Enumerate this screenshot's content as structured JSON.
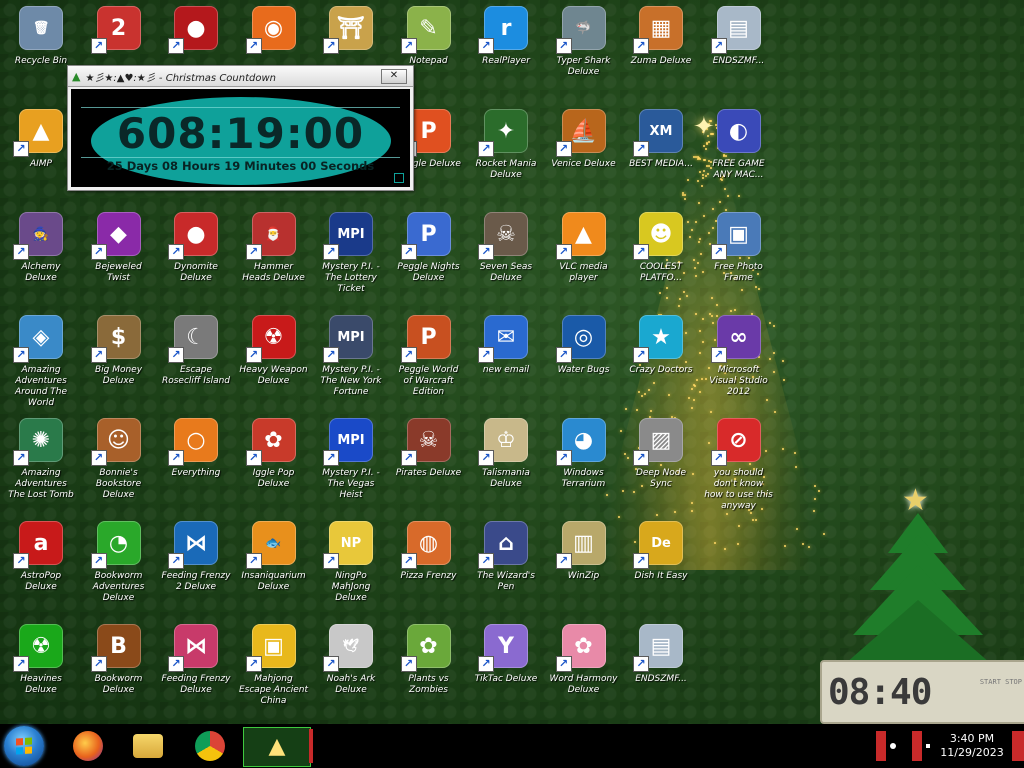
{
  "desktop": {
    "icons": [
      {
        "label": "Recycle Bin",
        "glyph": "🗑",
        "color": "#6e8aa8",
        "col": 0,
        "row": 0,
        "shortcut": false
      },
      {
        "label": "",
        "glyph": "2",
        "color": "#c9332f",
        "col": 1,
        "row": 0,
        "shortcut": true
      },
      {
        "label": "",
        "glyph": "●",
        "color": "#b4181c",
        "col": 2,
        "row": 0,
        "shortcut": true
      },
      {
        "label": "",
        "glyph": "◉",
        "color": "#e86b1c",
        "col": 3,
        "row": 0,
        "shortcut": true
      },
      {
        "label": "",
        "glyph": "⛩",
        "color": "#c9a24b",
        "col": 4,
        "row": 0,
        "shortcut": true
      },
      {
        "label": "Notepad",
        "glyph": "✎",
        "color": "#8bb24a",
        "col": 5,
        "row": 0,
        "shortcut": true
      },
      {
        "label": "RealPlayer",
        "glyph": "r",
        "color": "#1c8de0",
        "col": 6,
        "row": 0,
        "shortcut": true
      },
      {
        "label": "Typer Shark Deluxe",
        "glyph": "🦈",
        "color": "#6f8690",
        "col": 7,
        "row": 0,
        "shortcut": true
      },
      {
        "label": "Zuma Deluxe",
        "glyph": "▦",
        "color": "#c8702a",
        "col": 8,
        "row": 0,
        "shortcut": true
      },
      {
        "label": "ENDSZMF...",
        "glyph": "▤",
        "color": "#a8b8c8",
        "col": 9,
        "row": 0,
        "shortcut": true
      },
      {
        "label": "AIMP",
        "glyph": "▲",
        "color": "#e8a020",
        "col": 0,
        "row": 1,
        "shortcut": true
      },
      {
        "label": "Peggle Deluxe",
        "glyph": "P",
        "color": "#e05020",
        "col": 5,
        "row": 1,
        "shortcut": true
      },
      {
        "label": "Rocket Mania Deluxe",
        "glyph": "✦",
        "color": "#2b6c2b",
        "col": 6,
        "row": 1,
        "shortcut": true
      },
      {
        "label": "Venice Deluxe",
        "glyph": "⛵",
        "color": "#b8661c",
        "col": 7,
        "row": 1,
        "shortcut": true
      },
      {
        "label": "BEST MEDIA...",
        "glyph": "XM",
        "color": "#2a5a9a",
        "col": 8,
        "row": 1,
        "shortcut": true
      },
      {
        "label": "FREE GAME ANY MAC...",
        "glyph": "◐",
        "color": "#3a4ab8",
        "col": 9,
        "row": 1,
        "shortcut": false
      },
      {
        "label": "Alchemy Deluxe",
        "glyph": "🧙",
        "color": "#6a4a8a",
        "col": 0,
        "row": 2,
        "shortcut": true
      },
      {
        "label": "Bejeweled Twist",
        "glyph": "◆",
        "color": "#8a2aa8",
        "col": 1,
        "row": 2,
        "shortcut": true
      },
      {
        "label": "Dynomite Deluxe",
        "glyph": "●",
        "color": "#c82a2a",
        "col": 2,
        "row": 2,
        "shortcut": true
      },
      {
        "label": "Hammer Heads Deluxe",
        "glyph": "🎅",
        "color": "#b8312f",
        "col": 3,
        "row": 2,
        "shortcut": true
      },
      {
        "label": "Mystery P.I. - The Lottery Ticket",
        "glyph": "MPI",
        "color": "#1a3a8a",
        "col": 4,
        "row": 2,
        "shortcut": true
      },
      {
        "label": "Peggle Nights Deluxe",
        "glyph": "P",
        "color": "#3a6ad0",
        "col": 5,
        "row": 2,
        "shortcut": true
      },
      {
        "label": "Seven Seas Deluxe",
        "glyph": "☠",
        "color": "#6a5a4a",
        "col": 6,
        "row": 2,
        "shortcut": true
      },
      {
        "label": "VLC media player",
        "glyph": "▲",
        "color": "#f08a1c",
        "col": 7,
        "row": 2,
        "shortcut": true
      },
      {
        "label": "COOLEST PLATFO...",
        "glyph": "☻",
        "color": "#d8c820",
        "col": 8,
        "row": 2,
        "shortcut": true
      },
      {
        "label": "Free Photo Frame",
        "glyph": "▣",
        "color": "#4a7ab8",
        "col": 9,
        "row": 2,
        "shortcut": true
      },
      {
        "label": "Amazing Adventures Around The World",
        "glyph": "◈",
        "color": "#3a8ac8",
        "col": 0,
        "row": 3,
        "shortcut": true
      },
      {
        "label": "Big Money Deluxe",
        "glyph": "$",
        "color": "#8a6a3a",
        "col": 1,
        "row": 3,
        "shortcut": true
      },
      {
        "label": "Escape Rosecliff Island",
        "glyph": "☾",
        "color": "#7a7a7a",
        "col": 2,
        "row": 3,
        "shortcut": true
      },
      {
        "label": "Heavy Weapon Deluxe",
        "glyph": "☢",
        "color": "#c81a1a",
        "col": 3,
        "row": 3,
        "shortcut": true
      },
      {
        "label": "Mystery P.I. - The New York Fortune",
        "glyph": "MPI",
        "color": "#3a4a6a",
        "col": 4,
        "row": 3,
        "shortcut": true
      },
      {
        "label": "Peggle World of Warcraft Edition",
        "glyph": "P",
        "color": "#c85020",
        "col": 5,
        "row": 3,
        "shortcut": true
      },
      {
        "label": "new email",
        "glyph": "✉",
        "color": "#2a6ad0",
        "col": 6,
        "row": 3,
        "shortcut": true
      },
      {
        "label": "Water Bugs",
        "glyph": "◎",
        "color": "#1a5aa8",
        "col": 7,
        "row": 3,
        "shortcut": true
      },
      {
        "label": "Crazy Doctors",
        "glyph": "★",
        "color": "#1aa8d0",
        "col": 8,
        "row": 3,
        "shortcut": true
      },
      {
        "label": "Microsoft Visual Studio 2012",
        "glyph": "∞",
        "color": "#6a3aa8",
        "col": 9,
        "row": 3,
        "shortcut": true
      },
      {
        "label": "Amazing Adventures The Lost Tomb",
        "glyph": "✺",
        "color": "#2a7a4a",
        "col": 0,
        "row": 4,
        "shortcut": true
      },
      {
        "label": "Bonnie's Bookstore Deluxe",
        "glyph": "☺",
        "color": "#a8602a",
        "col": 1,
        "row": 4,
        "shortcut": true
      },
      {
        "label": "Everything",
        "glyph": "○",
        "color": "#e87a1c",
        "col": 2,
        "row": 4,
        "shortcut": true
      },
      {
        "label": "Iggle Pop Deluxe",
        "glyph": "✿",
        "color": "#c83a2a",
        "col": 3,
        "row": 4,
        "shortcut": true
      },
      {
        "label": "Mystery P.I. - The Vegas Heist",
        "glyph": "MPI",
        "color": "#1a4ac8",
        "col": 4,
        "row": 4,
        "shortcut": true
      },
      {
        "label": "Pirates Deluxe",
        "glyph": "☠",
        "color": "#8a3a2a",
        "col": 5,
        "row": 4,
        "shortcut": true
      },
      {
        "label": "Talismania Deluxe",
        "glyph": "♔",
        "color": "#c8b88a",
        "col": 6,
        "row": 4,
        "shortcut": true
      },
      {
        "label": "Windows Terrarium",
        "glyph": "◕",
        "color": "#2a8ad0",
        "col": 7,
        "row": 4,
        "shortcut": true
      },
      {
        "label": "Deep Node Sync",
        "glyph": "▨",
        "color": "#8a8a8a",
        "col": 8,
        "row": 4,
        "shortcut": true
      },
      {
        "label": "you should don't know how to use this anyway",
        "glyph": "⊘",
        "color": "#d82a2a",
        "col": 9,
        "row": 4,
        "shortcut": true
      },
      {
        "label": "AstroPop Deluxe",
        "glyph": "a",
        "color": "#c81a1a",
        "col": 0,
        "row": 5,
        "shortcut": true
      },
      {
        "label": "Bookworm Adventures Deluxe",
        "glyph": "◔",
        "color": "#2aa82a",
        "col": 1,
        "row": 5,
        "shortcut": true
      },
      {
        "label": "Feeding Frenzy 2 Deluxe",
        "glyph": "⋈",
        "color": "#1a6ab8",
        "col": 2,
        "row": 5,
        "shortcut": true
      },
      {
        "label": "Insaniquarium Deluxe",
        "glyph": "🐟",
        "color": "#e8901c",
        "col": 3,
        "row": 5,
        "shortcut": true
      },
      {
        "label": "NingPo MahJong Deluxe",
        "glyph": "NP",
        "color": "#e8c83a",
        "col": 4,
        "row": 5,
        "shortcut": true
      },
      {
        "label": "Pizza Frenzy",
        "glyph": "◍",
        "color": "#d86a2a",
        "col": 5,
        "row": 5,
        "shortcut": true
      },
      {
        "label": "The Wizard's Pen",
        "glyph": "⌂",
        "color": "#3a4a8a",
        "col": 6,
        "row": 5,
        "shortcut": true
      },
      {
        "label": "WinZip",
        "glyph": "▥",
        "color": "#b8a86a",
        "col": 7,
        "row": 5,
        "shortcut": true
      },
      {
        "label": "Dish It Easy",
        "glyph": "De",
        "color": "#d8a81c",
        "col": 8,
        "row": 5,
        "shortcut": true
      },
      {
        "label": "Heavines Deluxe",
        "glyph": "☢",
        "color": "#1aa81a",
        "col": 0,
        "row": 6,
        "shortcut": true
      },
      {
        "label": "Bookworm Deluxe",
        "glyph": "B",
        "color": "#8a4a1a",
        "col": 1,
        "row": 6,
        "shortcut": true
      },
      {
        "label": "Feeding Frenzy Deluxe",
        "glyph": "⋈",
        "color": "#c83a6a",
        "col": 2,
        "row": 6,
        "shortcut": true
      },
      {
        "label": "Mahjong Escape Ancient China",
        "glyph": "▣",
        "color": "#e8b81c",
        "col": 3,
        "row": 6,
        "shortcut": true
      },
      {
        "label": "Noah's Ark Deluxe",
        "glyph": "🕊",
        "color": "#c8c8c8",
        "col": 4,
        "row": 6,
        "shortcut": true
      },
      {
        "label": "Plants vs Zombies",
        "glyph": "✿",
        "color": "#6aa83a",
        "col": 5,
        "row": 6,
        "shortcut": true
      },
      {
        "label": "TikTac Deluxe",
        "glyph": "Y",
        "color": "#8a6ad0",
        "col": 6,
        "row": 6,
        "shortcut": true
      },
      {
        "label": "Word Harmony Deluxe",
        "glyph": "✿",
        "color": "#e88aa8",
        "col": 7,
        "row": 6,
        "shortcut": true
      },
      {
        "label": "ENDSZMF...",
        "glyph": "▤",
        "color": "#a8b8c8",
        "col": 8,
        "row": 6,
        "shortcut": true
      }
    ]
  },
  "countdown": {
    "title": "★彡★:▲♥:★彡 - Christmas Countdown",
    "time": "608:19:00",
    "subtitle": "25 Days 08 Hours 19 Minutes 00 Seconds",
    "close_label": "✕"
  },
  "widget_clock": {
    "digits": "08:40",
    "start_label": "START\nSTOP"
  },
  "taskbar": {
    "pinned": [
      {
        "name": "firefox",
        "color": "#e8621c"
      },
      {
        "name": "file-explorer",
        "color": "#e8c04a"
      },
      {
        "name": "chrome",
        "color": "#3aa84a"
      },
      {
        "name": "countdown-app",
        "color": "#2a8a2a"
      }
    ],
    "time": "3:40 PM",
    "date": "11/29/2023"
  }
}
